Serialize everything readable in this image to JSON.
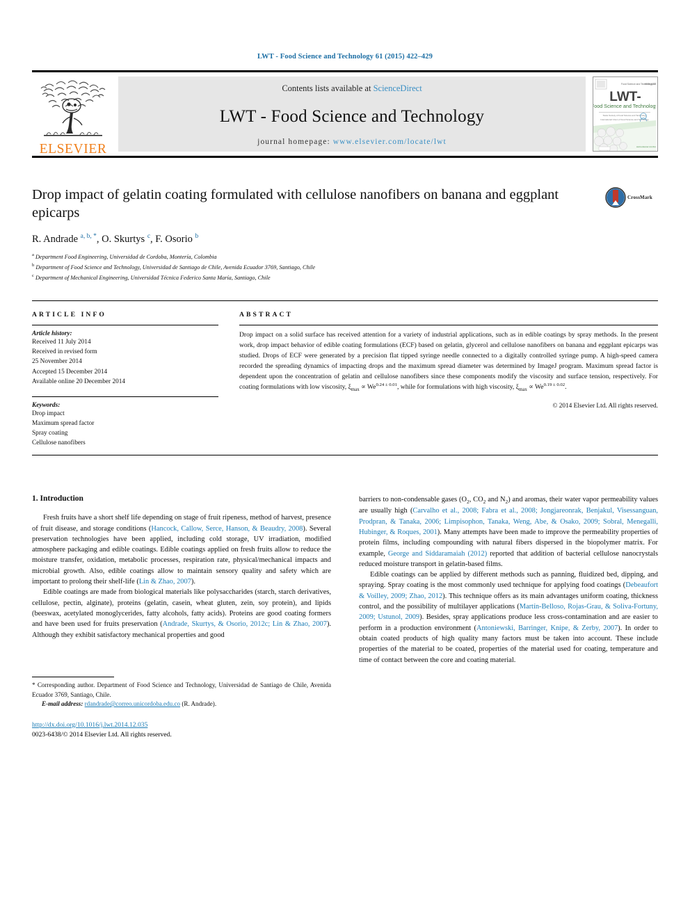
{
  "running_head": "LWT - Food Science and Technology 61 (2015) 422–429",
  "masthead": {
    "contents_prefix": "Contents lists available at ",
    "contents_link": "ScienceDirect",
    "journal_title": "LWT - Food Science and Technology",
    "homepage_prefix": "journal homepage: ",
    "homepage_url": "www.elsevier.com/locate/lwt",
    "publisher": "ELSEVIER",
    "cover": {
      "title_main": "LWT-",
      "title_sub": "Food Science and Technology"
    }
  },
  "article": {
    "title": "Drop impact of gelatin coating formulated with cellulose nanofibers on banana and eggplant epicarps",
    "crossmark_label": "CrossMark",
    "authors_html": "R. Andrade <sup>a, b, *</sup>, O. Skurtys <sup>c</sup>, F. Osorio <sup>b</sup>",
    "affiliations": [
      {
        "marker": "a",
        "text": "Department Food Engineering, Universidad de Cordoba, Montería, Colombia"
      },
      {
        "marker": "b",
        "text": "Department of Food Science and Technology, Universidad de Santiago de Chile, Avenida Ecuador 3769, Santiago, Chile"
      },
      {
        "marker": "c",
        "text": "Department of Mechanical Engineering, Universidad Técnica Federico Santa María, Santiago, Chile"
      }
    ]
  },
  "info": {
    "heading": "ARTICLE INFO",
    "history_label": "Article history:",
    "history": [
      "Received 11 July 2014",
      "Received in revised form",
      "25 November 2014",
      "Accepted 15 December 2014",
      "Available online 20 December 2014"
    ],
    "keywords_label": "Keywords:",
    "keywords": [
      "Drop impact",
      "Maximum spread factor",
      "Spray coating",
      "Cellulose nanofibers"
    ]
  },
  "abstract": {
    "heading": "ABSTRACT",
    "text_html": "Drop impact on a solid surface has received attention for a variety of industrial applications, such as in edible coatings by spray methods. In the present work, drop impact behavior of edible coating formulations (ECF) based on gelatin, glycerol and cellulose nanofibers on banana and eggplant epicarps was studied. Drops of ECF were generated by a precision flat tipped syringe needle connected to a digitally controlled syringe pump. A high-speed camera recorded the spreading dynamics of impacting drops and the maximum spread diameter was determined by ImageJ program. Maximum spread factor is dependent upon the concentration of gelatin and cellulose nanofibers since these components modify the viscosity and surface tension, respectively. For coating formulations with low viscosity, ξ<sub>max</sub> ∝ We<sup class=\"sm\">0.24 ± 0.01</sup>, while for formulations with high viscosity, ξ<sub>max</sub> ∝ We<sup class=\"sm\">0.19 ± 0.02</sup>.",
    "copyright": "© 2014 Elsevier Ltd. All rights reserved."
  },
  "body": {
    "section_number_title": "1. Introduction",
    "left_paragraphs_html": [
      "Fresh fruits have a short shelf life depending on stage of fruit ripeness, method of harvest, presence of fruit disease, and storage conditions (<span class=\"ref\">Hancock, Callow, Serce, Hanson, &amp; Beaudry, 2008</span>). Several preservation technologies have been applied, including cold storage, UV irradiation, modified atmosphere packaging and edible coatings. Edible coatings applied on fresh fruits allow to reduce the moisture transfer, oxidation, metabolic processes, respiration rate, physical/mechanical impacts and microbial growth. Also, edible coatings allow to maintain sensory quality and safety which are important to prolong their shelf-life (<span class=\"ref\">Lin &amp; Zhao, 2007</span>).",
      "Edible coatings are made from biological materials like polysaccharides (starch, starch derivatives, cellulose, pectin, alginate), proteins (gelatin, casein, wheat gluten, zein, soy protein), and lipids (beeswax, acetylated monoglycerides, fatty alcohols, fatty acids). Proteins are good coating formers and have been used for fruits preservation (<span class=\"ref\">Andrade, Skurtys, &amp; Osorio, 2012c; Lin &amp; Zhao, 2007</span>). Although they exhibit satisfactory mechanical properties and good"
    ],
    "right_paragraphs_html": [
      "barriers to non-condensable gases (O<sub>2</sub>, CO<sub>2</sub> and N<sub>2</sub>) and aromas, their water vapor permeability values are usually high (<span class=\"ref\">Carvalho et al., 2008; Fabra et al., 2008; Jongjareonrak, Benjakul, Visessanguan, Prodpran, &amp; Tanaka, 2006; Limpisophon, Tanaka, Weng, Abe, &amp; Osako, 2009; Sobral, Menegalli, Hubinger, &amp; Roques, 2001</span>). Many attempts have been made to improve the permeability properties of protein films, including compounding with natural fibers dispersed in the biopolymer matrix. For example, <span class=\"ref\">George and Siddaramaiah (2012)</span> reported that addition of bacterial cellulose nanocrystals reduced moisture transport in gelatin-based films.",
      "Edible coatings can be applied by different methods such as panning, fluidized bed, dipping, and spraying. Spray coating is the most commonly used technique for applying food coatings (<span class=\"ref\">Debeaufort &amp; Voilley, 2009; Zhao, 2012</span>). This technique offers as its main advantages uniform coating, thickness control, and the possibility of multilayer applications (<span class=\"ref\">Martín-Belloso, Rojas-Grau, &amp; Soliva-Fortuny, 2009; Ustunol, 2009</span>). Besides, spray applications produce less cross-contamination and are easier to perform in a production environment (<span class=\"ref\">Antoniewski, Barringer, Knipe, &amp; Zerby, 2007</span>). In order to obtain coated products of high quality many factors must be taken into account. These include properties of the material to be coated, properties of the material used for coating, temperature and time of contact between the core and coating material."
    ]
  },
  "footer": {
    "corresponding_html": "* Corresponding author. Department of Food Science and Technology, Universidad de Santiago de Chile, Avenida Ecuador 3769, Santiago, Chile.",
    "email_label": "E-mail address:",
    "email": "rdandrade@correo.unicordoba.edu.co",
    "email_owner": "(R. Andrade).",
    "doi_url": "http://dx.doi.org/10.1016/j.lwt.2014.12.035",
    "issn_line": "0023-6438/© 2014 Elsevier Ltd. All rights reserved."
  },
  "colors": {
    "link": "#1c7cb5",
    "running_head": "#1c6ea4",
    "elsevier_orange": "#f07f1a",
    "masthead_bg": "#e6e6e6"
  }
}
